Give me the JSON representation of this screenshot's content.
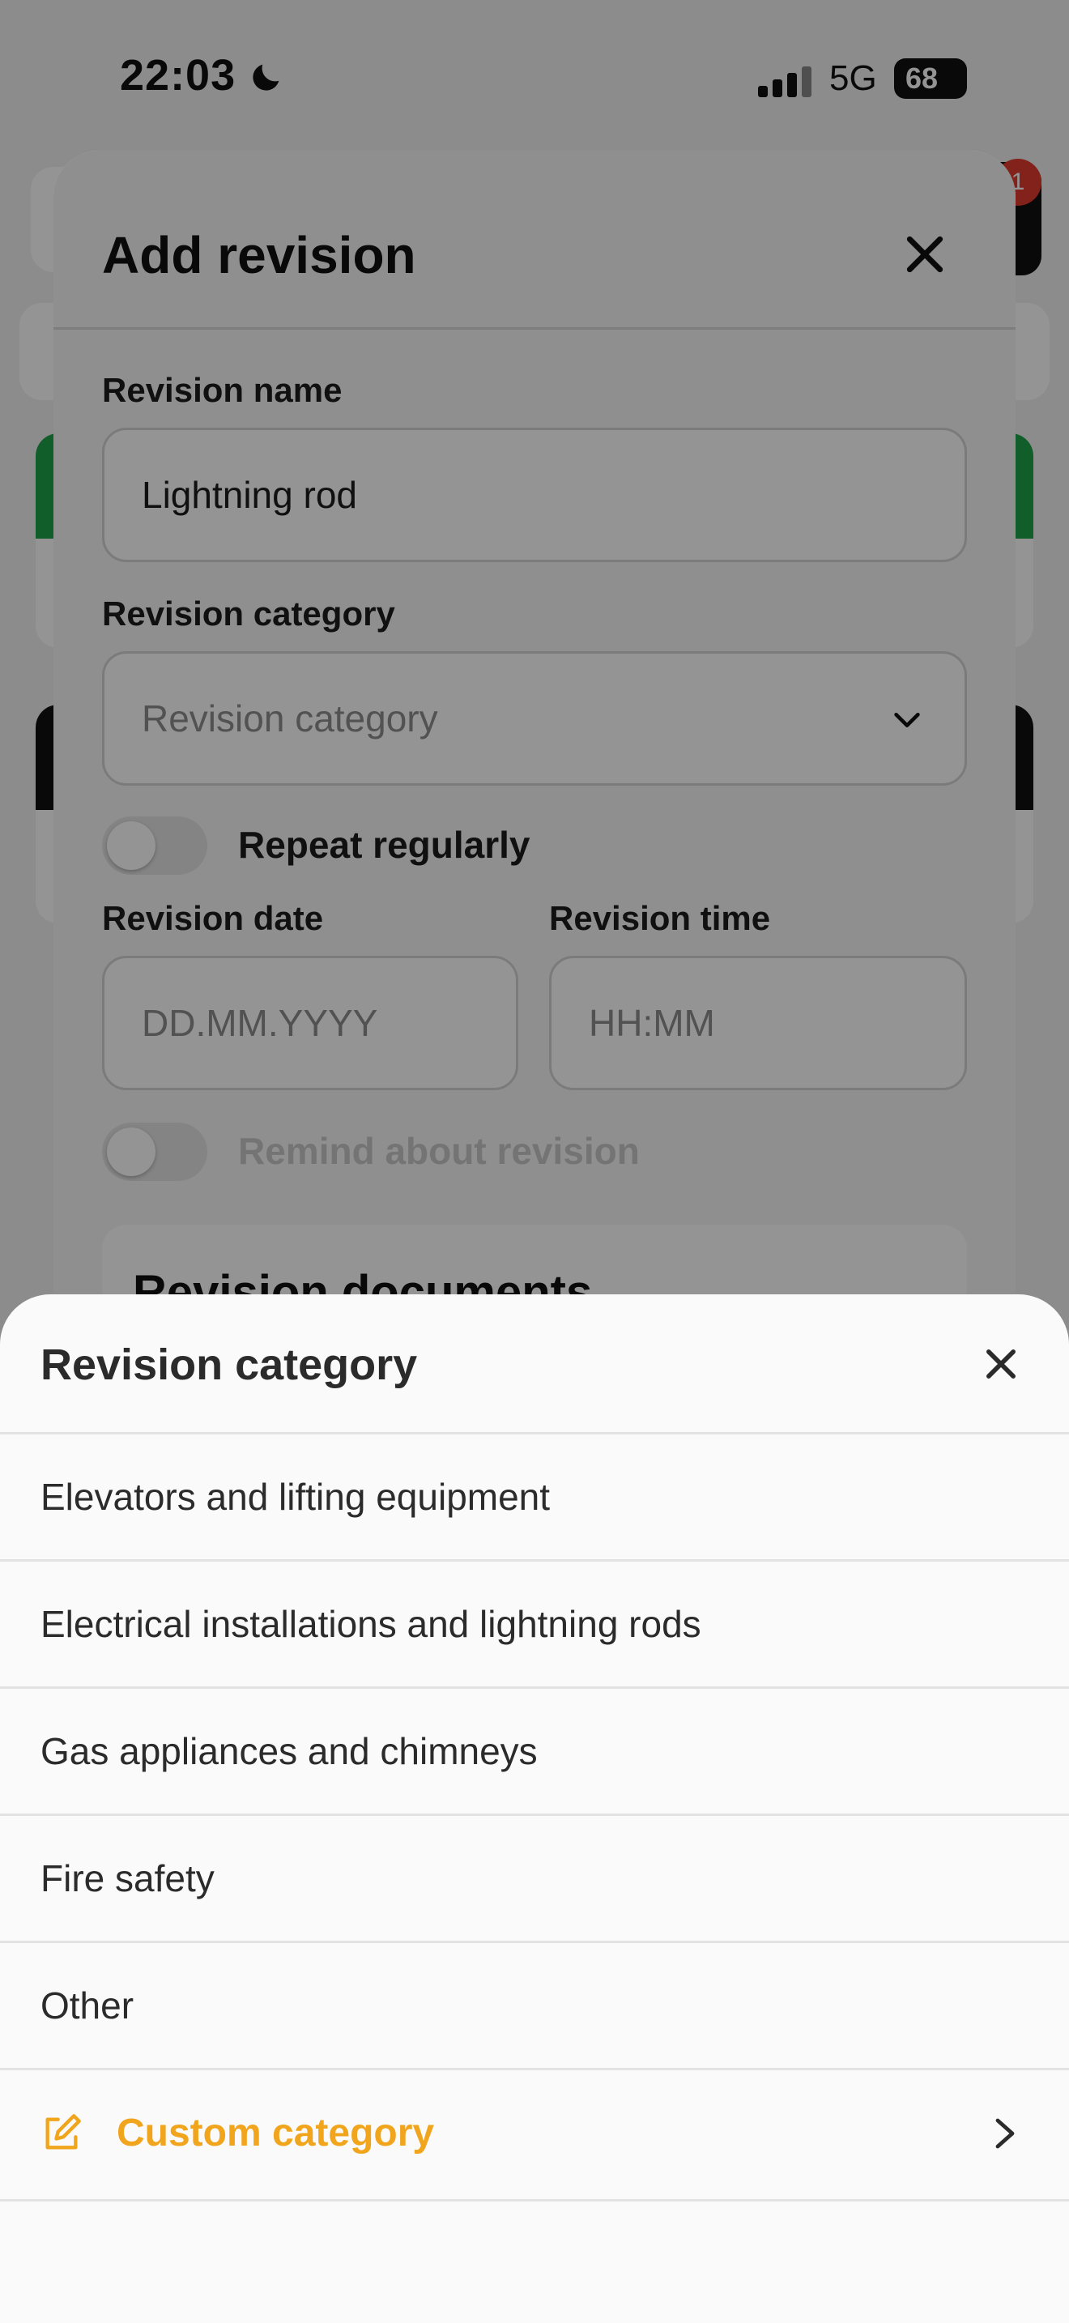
{
  "status_bar": {
    "time": "22:03",
    "network": "5G",
    "battery": "68"
  },
  "background": {
    "badge_count": "1"
  },
  "modal": {
    "title": "Add revision",
    "revision_name_label": "Revision name",
    "revision_name_value": "Lightning rod",
    "revision_category_label": "Revision category",
    "revision_category_placeholder": "Revision category",
    "repeat_label": "Repeat regularly",
    "repeat_on": false,
    "revision_date_label": "Revision date",
    "revision_date_placeholder": "DD.MM.YYYY",
    "revision_time_label": "Revision time",
    "revision_time_placeholder": "HH:MM",
    "remind_label": "Remind about revision",
    "remind_on": false,
    "documents_title": "Revision documents"
  },
  "sheet": {
    "title": "Revision category",
    "options": [
      "Elevators and lifting equipment",
      "Electrical installations and lightning rods",
      "Gas appliances and chimneys",
      "Fire safety",
      "Other"
    ],
    "custom_label": "Custom category",
    "accent_color": "#f0a51d"
  },
  "icons": [
    "moon-icon",
    "signal-icon",
    "close-icon",
    "chevron-down-icon",
    "edit-icon",
    "chevron-right-icon"
  ]
}
